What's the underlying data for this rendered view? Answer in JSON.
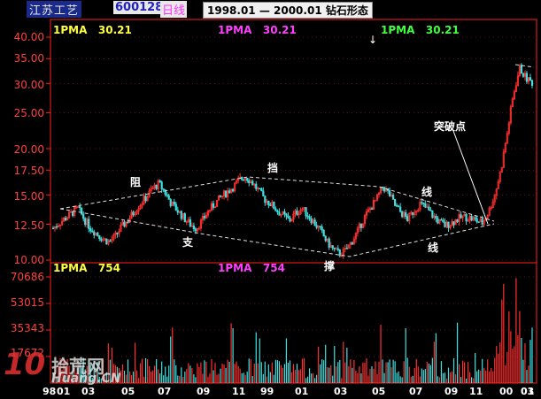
{
  "header": {
    "name": "江苏工艺",
    "code": "600128",
    "period": "日线",
    "title": "1998.01 — 2000.01 钻石形态"
  },
  "price_panel": {
    "ma_labels": [
      {
        "text": "1PMA",
        "value": "30.21",
        "color": "#ffff40"
      },
      {
        "text": "1PMA",
        "value": "30.21",
        "color": "#ff40ff"
      },
      {
        "text": "1PMA",
        "value": "30.21",
        "color": "#40ff40"
      }
    ],
    "y_ticks": [
      "40.00",
      "35.00",
      "30.00",
      "25.00",
      "20.00",
      "17.50",
      "15.00",
      "12.50",
      "10.00"
    ],
    "annotations": {
      "zu": "阻",
      "dang": "挡",
      "xian1": "线",
      "zhi": "支",
      "cheng": "撑",
      "xian2": "线",
      "breakout": "突破点"
    },
    "arrow": "↓"
  },
  "volume_panel": {
    "ma_labels": [
      {
        "text": "1PMA",
        "value": "754",
        "color": "#ffff40"
      },
      {
        "text": "1PMA",
        "value": "754",
        "color": "#ff40ff"
      }
    ],
    "y_ticks": [
      "70686",
      "53015",
      "35343",
      "17672"
    ]
  },
  "x_labels": [
    "98",
    "01",
    "03",
    "05",
    "07",
    "09",
    "11",
    "99",
    "01",
    "03",
    "05",
    "07",
    "09",
    "11",
    "00",
    "01",
    "03"
  ],
  "watermark": {
    "logo": "10",
    "brand": "拾荒网",
    "site": "Huang.CN"
  },
  "colors": {
    "up": "#ff3030",
    "down": "#40e0e0",
    "axis": "#ff2020",
    "grid": "#c02020",
    "label": "#ff4040"
  },
  "chart_data": {
    "type": "candlestick",
    "price_ylim": [
      10,
      40
    ],
    "price_scale": "log",
    "volume_ylim": [
      0,
      70686
    ],
    "approx_closes": [
      12.2,
      12.6,
      13.0,
      13.4,
      13.8,
      12.9,
      12.2,
      11.8,
      11.4,
      11.2,
      11.6,
      12.3,
      12.8,
      13.5,
      14.2,
      14.8,
      15.6,
      16.1,
      15.2,
      14.2,
      13.6,
      13.0,
      12.5,
      12.2,
      12.8,
      13.6,
      14.2,
      14.8,
      15.3,
      15.8,
      16.5,
      16.8,
      16.2,
      15.4,
      14.6,
      14.2,
      13.6,
      13.2,
      12.8,
      13.4,
      13.8,
      13.2,
      12.6,
      12.0,
      11.2,
      10.7,
      10.4,
      10.6,
      11.2,
      12.0,
      13.0,
      13.8,
      14.6,
      15.8,
      15.1,
      14.0,
      13.4,
      12.9,
      13.6,
      14.2,
      13.8,
      13.2,
      12.7,
      12.4,
      12.6,
      12.9,
      13.1,
      13.0,
      12.8,
      12.6,
      13.5,
      15.0,
      17.5,
      22.0,
      28.0,
      33.0,
      31.0,
      30.2
    ]
  }
}
